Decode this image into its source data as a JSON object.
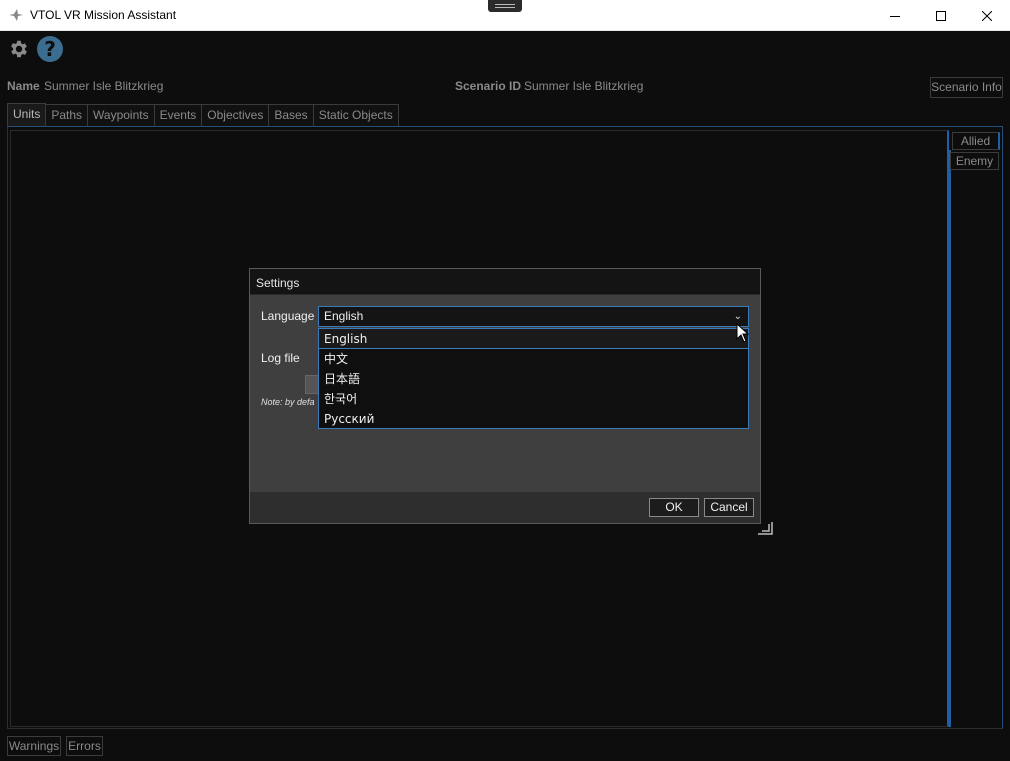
{
  "window": {
    "title": "VTOL VR Mission Assistant"
  },
  "toolbar": {
    "settings_icon": "gear-icon",
    "help_icon": "help-icon",
    "help_glyph": "?"
  },
  "scenario": {
    "name_label": "Name",
    "name_value": "Summer Isle Blitzkrieg",
    "id_label": "Scenario ID",
    "id_value": "Summer Isle Blitzkrieg",
    "info_button": "Scenario Info"
  },
  "tabs": [
    {
      "label": "Units",
      "active": true
    },
    {
      "label": "Paths"
    },
    {
      "label": "Waypoints"
    },
    {
      "label": "Events"
    },
    {
      "label": "Objectives"
    },
    {
      "label": "Bases"
    },
    {
      "label": "Static Objects"
    }
  ],
  "side_tabs": {
    "allied": "Allied",
    "enemy": "Enemy"
  },
  "bottom": {
    "warnings": "Warnings",
    "errors": "Errors"
  },
  "dialog": {
    "title": "Settings",
    "language_label": "Language",
    "language_value": "English",
    "language_options": [
      "English",
      "中文",
      "日本語",
      "한국어",
      "Русский"
    ],
    "logfile_label": "Log file",
    "note": "Note: by defa",
    "ok": "OK",
    "cancel": "Cancel"
  },
  "colors": {
    "accent": "#3b79b8",
    "help_circle": "#3a6d8f",
    "background": "#0d0d0d"
  }
}
